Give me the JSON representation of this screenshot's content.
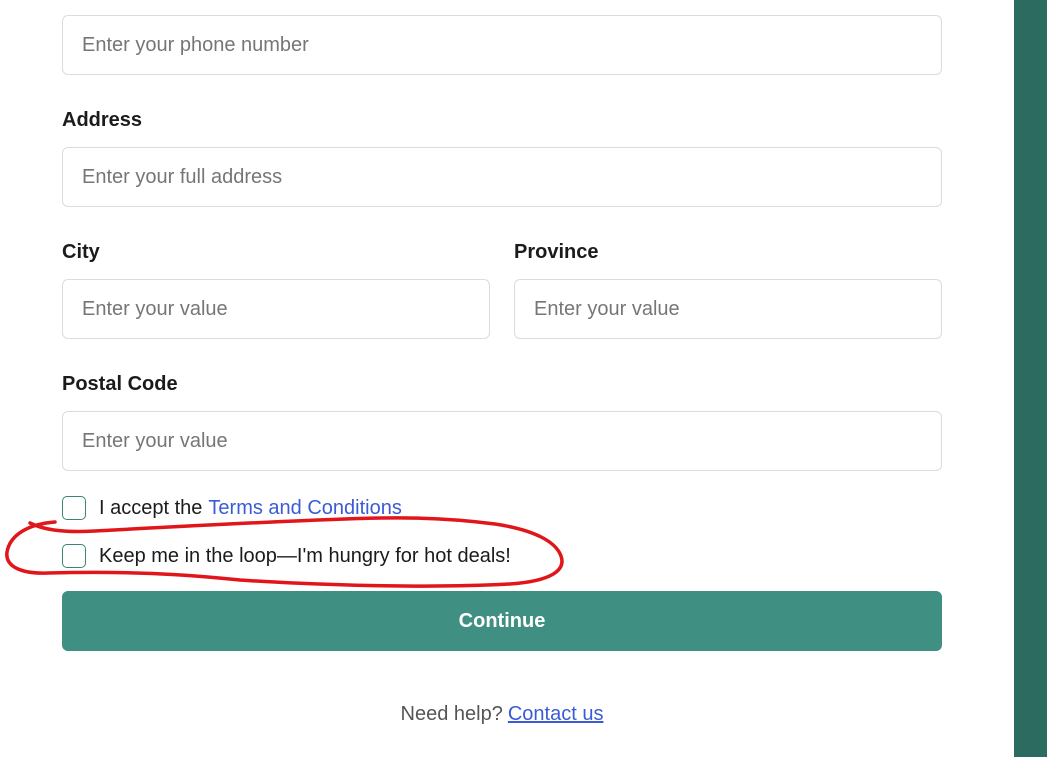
{
  "form": {
    "phone": {
      "placeholder": "Enter your phone number"
    },
    "address": {
      "label": "Address",
      "placeholder": "Enter your full address"
    },
    "city": {
      "label": "City",
      "placeholder": "Enter your value"
    },
    "province": {
      "label": "Province",
      "placeholder": "Enter your value"
    },
    "postal_code": {
      "label": "Postal Code",
      "placeholder": "Enter your value"
    },
    "terms": {
      "prefix": "I accept the",
      "link": "Terms and Conditions",
      "checked": false
    },
    "newsletter": {
      "label": "Keep me in the loop—I'm hungry for hot deals!",
      "checked": false
    },
    "continue_label": "Continue"
  },
  "footer": {
    "help_text": "Need help?",
    "contact_link": "Contact us"
  },
  "colors": {
    "accent": "#3f8f82",
    "side_panel": "#2c6b5f",
    "link": "#3b5bd6",
    "annotation": "#e0161a"
  }
}
